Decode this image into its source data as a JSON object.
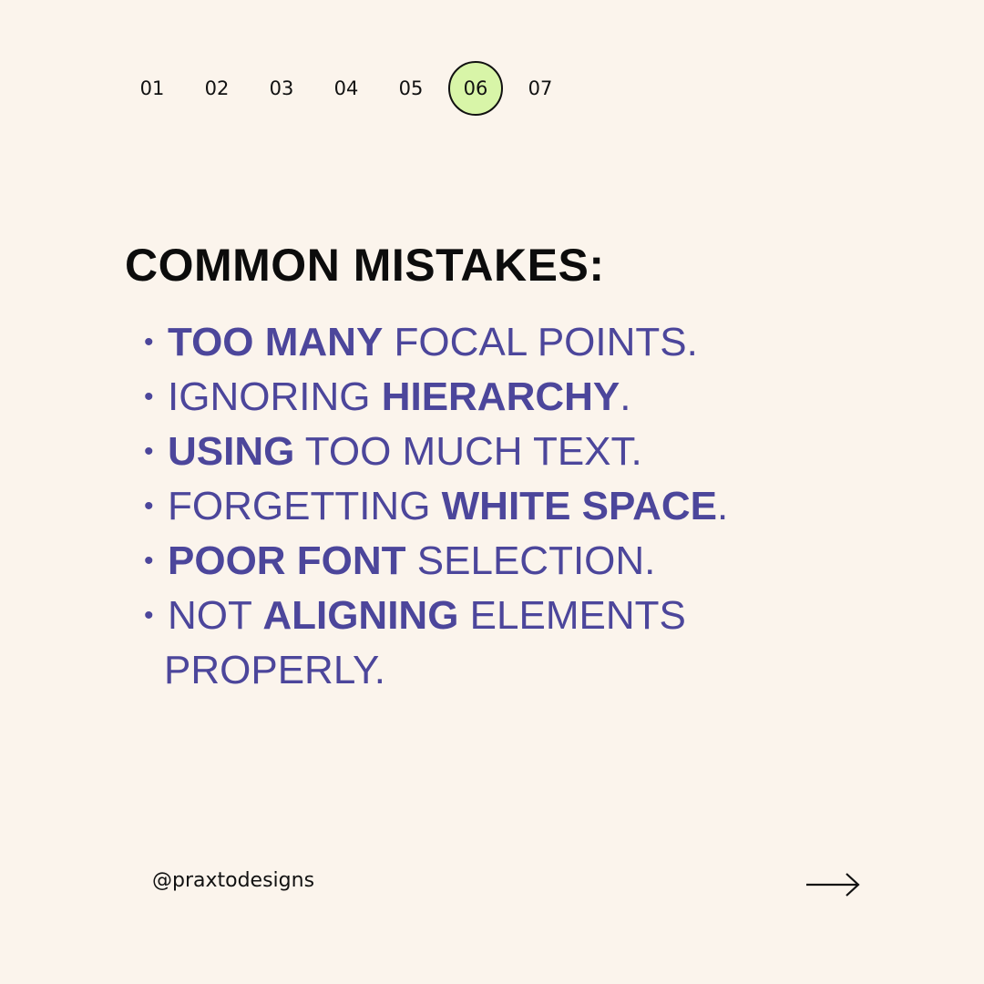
{
  "pagination": {
    "pages": [
      "01",
      "02",
      "03",
      "04",
      "05",
      "06",
      "07"
    ],
    "current": "06"
  },
  "heading": "COMMON MISTAKES:",
  "items": [
    {
      "parts": [
        {
          "t": "TOO MANY",
          "b": true
        },
        {
          "t": " FOCAL POINTS.",
          "b": false
        }
      ]
    },
    {
      "parts": [
        {
          "t": "IGNORING ",
          "b": false
        },
        {
          "t": "HIERARCHY",
          "b": true
        },
        {
          "t": ".",
          "b": false
        }
      ]
    },
    {
      "parts": [
        {
          "t": "USING",
          "b": true
        },
        {
          "t": " TOO MUCH TEXT.",
          "b": false
        }
      ]
    },
    {
      "parts": [
        {
          "t": "FORGETTING ",
          "b": false
        },
        {
          "t": "WHITE SPACE",
          "b": true
        },
        {
          "t": ".",
          "b": false
        }
      ]
    },
    {
      "parts": [
        {
          "t": "POOR FONT",
          "b": true
        },
        {
          "t": " SELECTION.",
          "b": false
        }
      ]
    },
    {
      "parts": [
        {
          "t": "NOT ",
          "b": false
        },
        {
          "t": "ALIGNING",
          "b": true
        },
        {
          "t": " ELEMENTS",
          "b": false
        }
      ]
    }
  ],
  "items_continuation": "PROPERLY.",
  "bullet": "•",
  "handle": "@praxtodesigns",
  "colors": {
    "background": "#fbf4ec",
    "accent_text": "#4c469b",
    "active_page": "#d8f5a8",
    "heading": "#0c0c0c"
  },
  "icons": {
    "next": "right-arrow-icon"
  }
}
